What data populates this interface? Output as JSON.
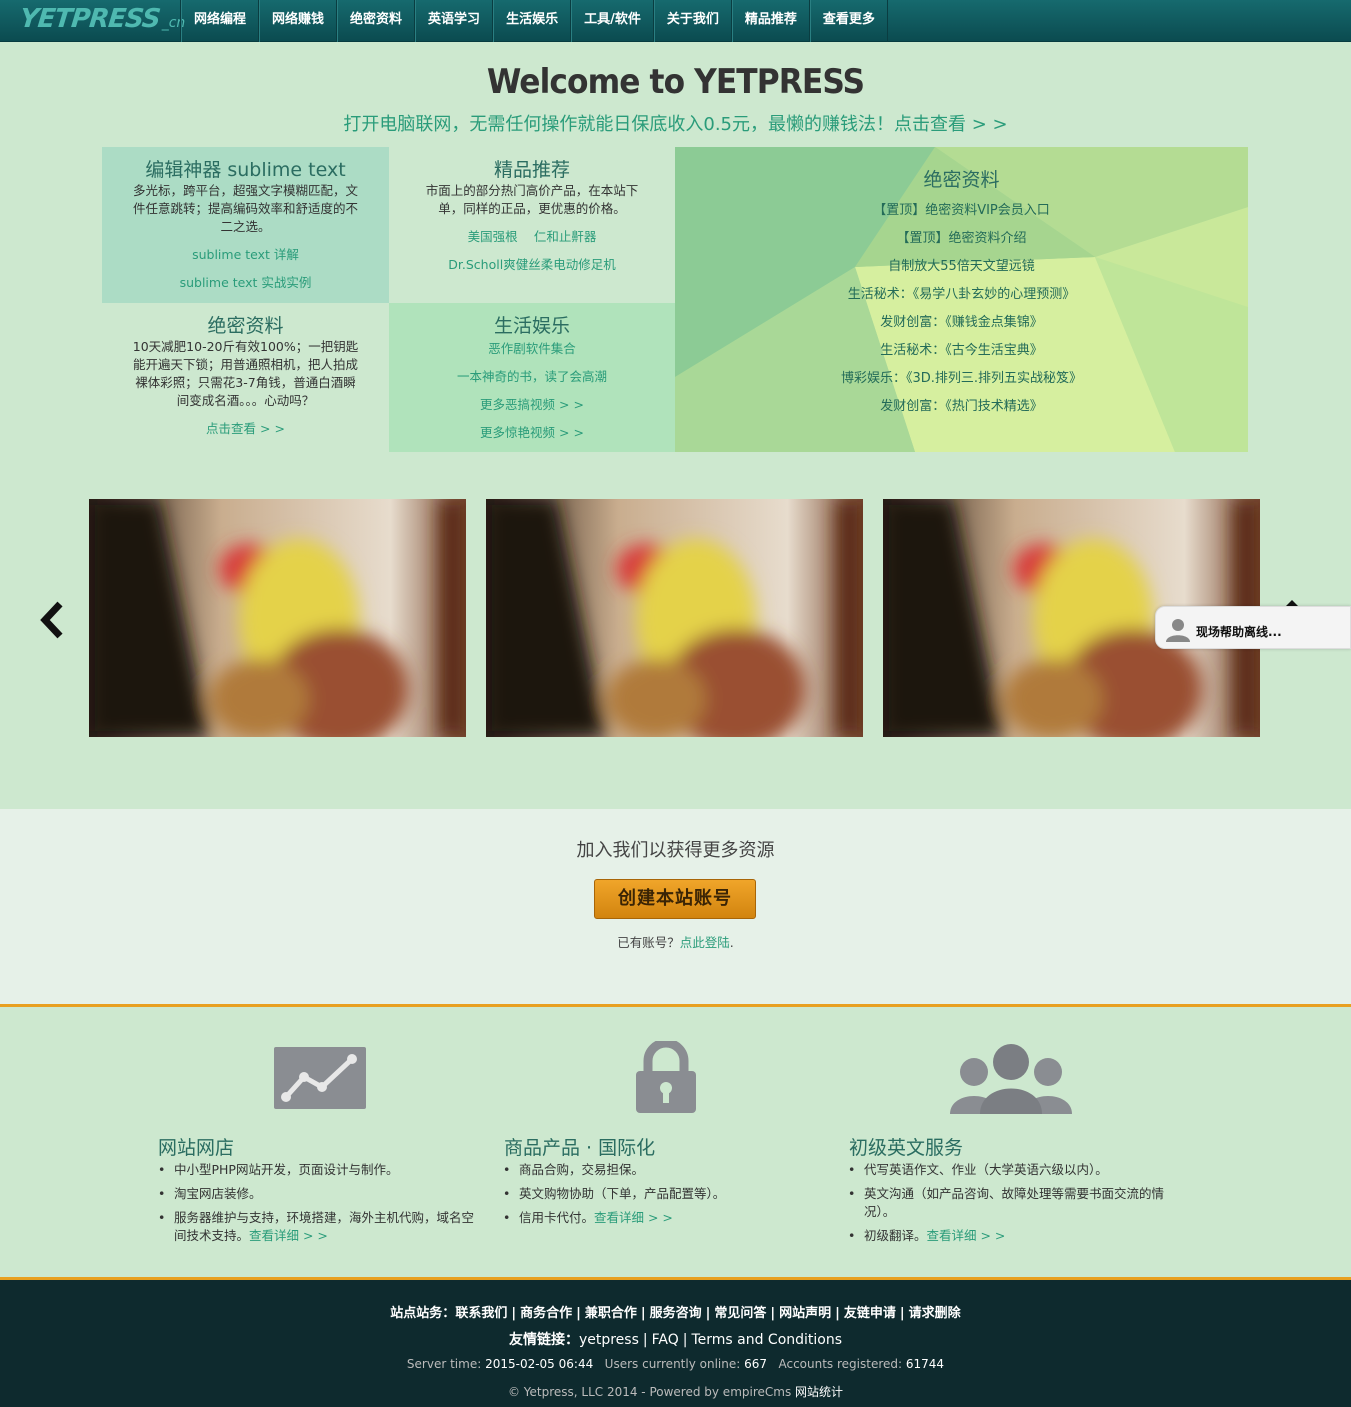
{
  "logo": {
    "main": "YETPRESS",
    "suffix": "_cn"
  },
  "nav": [
    "网络编程",
    "网络赚钱",
    "绝密资料",
    "英语学习",
    "生活娱乐",
    "工具/软件",
    "关于我们",
    "精品推荐",
    "查看更多"
  ],
  "hero": {
    "title": "Welcome to YETPRESS",
    "tagline": "打开电脑联网，无需任何操作就能日保底收入0.5元，最懒的赚钱法！点击查看 > >"
  },
  "grid": {
    "sublime": {
      "title": "编辑神器 sublime text",
      "desc": "多光标，跨平台，超强文字模糊匹配，文件任意跳转；提高编码效率和舒适度的不二之选。",
      "links": [
        "sublime text 详解",
        "sublime text 实战实例"
      ]
    },
    "featured": {
      "title": "精品推荐",
      "desc": "市面上的部分热门高价产品，在本站下单，同样的正品，更优惠的价格。",
      "links": [
        "美国强根",
        "仁和止鼾器",
        "Dr.Scholl爽健丝柔电动修足机"
      ]
    },
    "secret_small": {
      "title": "绝密资料",
      "desc": "10天减肥10-20斤有效100%；一把钥匙能开遍天下锁；用普通照相机，把人拍成裸体彩照；只需花3-7角钱，普通白酒瞬间变成名酒。。。心动吗？",
      "link": "点击查看 > >"
    },
    "entertainment": {
      "title": "生活娱乐",
      "links": [
        "恶作剧软件集合",
        "一本神奇的书，读了会高潮",
        "更多恶搞视频 > >",
        "更多惊艳视频 > >"
      ]
    },
    "secret_big": {
      "title": "绝密资料",
      "links": [
        "【置顶】绝密资料VIP会员入口",
        "【置顶】绝密资料介绍",
        "自制放大55倍天文望远镜",
        "生活秘术：《易学八卦玄妙的心理预测》",
        "发财创富：《赚钱金点集锦》",
        "生活秘术：《古今生活宝典》",
        "博彩娱乐：《3D.排列三.排列五实战秘笈》",
        "发财创富：《热门技术精选》"
      ]
    }
  },
  "help_widget": {
    "label": "现场帮助离线..."
  },
  "join": {
    "title": "加入我们以获得更多资源",
    "button": "创建本站账号",
    "login_prefix": "已有账号？",
    "login_link": "点此登陆",
    "login_suffix": "."
  },
  "services": [
    {
      "title": "网站网店",
      "items": [
        "中小型PHP网站开发，页面设计与制作。",
        "淘宝网店装修。",
        "服务器维护与支持，环境搭建，海外主机代购，域名空间技术支持。"
      ],
      "more": "查看详细 > >"
    },
    {
      "title": "商品产品 · 国际化",
      "items": [
        "商品合购，交易担保。",
        "英文购物协助（下单，产品配置等）。",
        "信用卡代付。"
      ],
      "more": "查看详细 > >"
    },
    {
      "title": "初级英文服务",
      "items": [
        "代写英语作文、作业（大学英语六级以内）。",
        "英文沟通（如产品咨询、故障处理等需要书面交流的情况）。",
        "初级翻译。"
      ],
      "more": "查看详细 > >"
    }
  ],
  "footer": {
    "site_label": "站点站务：",
    "site_links": [
      "联系我们",
      "商务合作",
      "兼职合作",
      "服务咨询",
      "常见问答",
      "网站声明",
      "友链申请",
      "请求删除"
    ],
    "friend_label": "友情链接：",
    "friend_links": [
      "yetpress",
      "FAQ",
      "Terms and Conditions"
    ],
    "server_time_label": "Server time:",
    "server_time": "2015-02-05 06:44",
    "online_label": "Users currently online:",
    "online": "667",
    "registered_label": "Accounts registered:",
    "registered": "61744",
    "copyright": "© Yetpress, LLC 2014 - Powered by empireCms",
    "stats": "网站统计"
  }
}
